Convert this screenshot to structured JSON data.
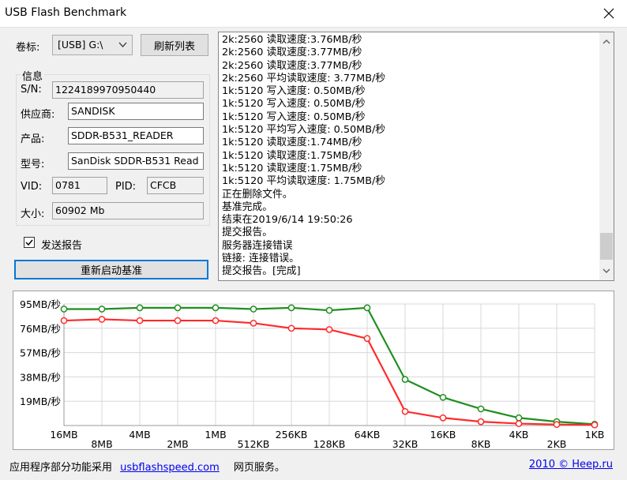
{
  "window": {
    "title": "USB Flash Benchmark"
  },
  "volume": {
    "label": "卷标:",
    "selected": "[USB] G:\\",
    "refresh_label": "刷新列表"
  },
  "info": {
    "group_title": "信息",
    "sn_label": "S/N:",
    "sn": "1224189970950440",
    "vendor_label": "供应商:",
    "vendor": "SANDISK",
    "product_label": "产品:",
    "product": "SDDR-B531_READER",
    "model_label": "型号:",
    "model": "SanDisk SDDR-B531 Read",
    "vid_label": "VID:",
    "vid": "0781",
    "pid_label": "PID:",
    "pid": "CFCB",
    "size_label": "大小:",
    "size": "60902 Mb"
  },
  "send_report": {
    "label": "发送报告",
    "checked": true
  },
  "restart_label": "重新启动基准",
  "log": [
    "2k:2560 读取速度:3.76MB/秒",
    "2k:2560 读取速度:3.77MB/秒",
    "2k:2560 读取速度:3.77MB/秒",
    "2k:2560 平均读取速度: 3.77MB/秒",
    "1k:5120 写入速度: 0.50MB/秒",
    "1k:5120 写入速度: 0.50MB/秒",
    "1k:5120 写入速度: 0.50MB/秒",
    "1k:5120 平均写入速度: 0.50MB/秒",
    "1k:5120 读取速度:1.74MB/秒",
    "1k:5120 读取速度:1.75MB/秒",
    "1k:5120 读取速度:1.75MB/秒",
    "1k:5120 平均读取速度: 1.75MB/秒",
    "正在删除文件。",
    "基准完成。",
    "结束在2019/6/14 19:50:26",
    "提交报告。",
    "服务器连接错误",
    "链接: 连接错误。",
    "提交报告。[完成]"
  ],
  "chart_data": {
    "type": "line",
    "x": [
      "16MB",
      "8MB",
      "4MB",
      "2MB",
      "1MB",
      "512KB",
      "256KB",
      "128KB",
      "64KB",
      "32KB",
      "16KB",
      "8KB",
      "4KB",
      "2KB",
      "1KB"
    ],
    "y_ticks": [
      "95MB/秒",
      "76MB/秒",
      "57MB/秒",
      "38MB/秒",
      "19MB/秒"
    ],
    "ylim": [
      0,
      95
    ],
    "grid": true,
    "series": [
      {
        "color": "#1f8f1f",
        "values": [
          91,
          91,
          92,
          92,
          92,
          91,
          92,
          90,
          92,
          36,
          22,
          13,
          6,
          3,
          1
        ]
      },
      {
        "color": "#ff2a2a",
        "values": [
          82,
          83,
          82,
          82,
          82,
          80,
          76,
          75,
          68,
          11,
          6,
          3,
          1.5,
          0.8,
          0.5
        ]
      }
    ]
  },
  "footer": {
    "left_text": "应用程序部分功能采用",
    "link": "usbflashspeed.com",
    "right_text": "网页服务。",
    "copyright": "2010 © Heep.ru"
  }
}
